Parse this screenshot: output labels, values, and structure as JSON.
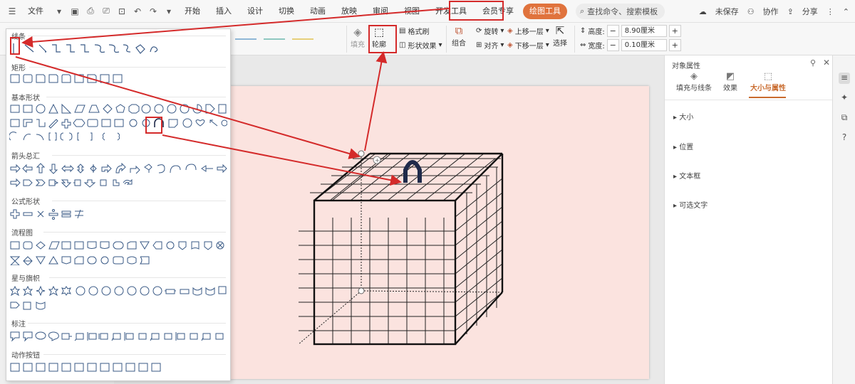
{
  "menubar": {
    "file_label": "文件",
    "tabs": [
      "开始",
      "插入",
      "设计",
      "切换",
      "动画",
      "放映",
      "审阅",
      "视图",
      "开发工具",
      "会员专享",
      "绘图工具"
    ],
    "active_tab": "绘图工具",
    "search_label": "查找命令、搜索模板",
    "unsaved_label": "未保存",
    "collab_label": "协作",
    "share_label": "分享"
  },
  "ribbon": {
    "fill_label": "填充",
    "outline_label": "轮廓",
    "format_painter_label": "格式刷",
    "shape_effect_label": "形状效果",
    "group_label": "组合",
    "rotate_label": "旋转",
    "align_label": "对齐",
    "bring_forward_label": "上移一层",
    "send_backward_label": "下移一层",
    "select_label": "选择",
    "height_label": "高度:",
    "height_value": "8.90厘米",
    "width_label": "宽度:",
    "width_value": "0.10厘米"
  },
  "shape_panel": {
    "categories": [
      "线条",
      "矩形",
      "基本形状",
      "箭头总汇",
      "公式形状",
      "流程图",
      "星与旗帜",
      "标注",
      "动作按钮"
    ]
  },
  "right_panel": {
    "title": "对象属性",
    "tabs": [
      "填充与线条",
      "效果",
      "大小与属性"
    ],
    "active_tab": "大小与属性",
    "sections": [
      "大小",
      "位置",
      "文本框",
      "可选文字"
    ]
  },
  "colors": {
    "accent": "#e0733d",
    "annotation_red": "#d42a2a",
    "slide_bg": "#fbe3df",
    "handle_navy": "#1f2a4a"
  }
}
